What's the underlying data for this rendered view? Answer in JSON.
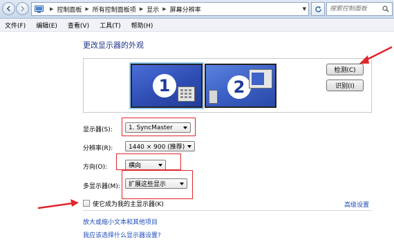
{
  "address_bar": {
    "crumbs": [
      "控制面板",
      "所有控制面板项",
      "显示",
      "屏幕分辨率"
    ],
    "search_placeholder": "搜索控制面板"
  },
  "menu": [
    "文件(F)",
    "编辑(E)",
    "查看(V)",
    "工具(T)",
    "帮助(H)"
  ],
  "page_title": "更改显示器的外观",
  "monitors": [
    "1",
    "2"
  ],
  "buttons": {
    "detect": "检测(C)",
    "identify": "识别(I)"
  },
  "fields": {
    "display": {
      "label": "显示器(S):",
      "value": "1. SyncMaster"
    },
    "resolution": {
      "label": "分辨率(R):",
      "value": "1440 × 900 (推荐)"
    },
    "orientation": {
      "label": "方向(O):",
      "value": "横向"
    },
    "multiple_displays": {
      "label": "多显示器(M):",
      "value": "扩展这些显示"
    }
  },
  "primary_checkbox": {
    "label": "使它成为我的主显示器(K)",
    "checked": false
  },
  "links": {
    "advanced": "高级设置",
    "text_size": "放大或缩小文本和其他项目",
    "which_settings": "我应该选择什么显示器设置?"
  },
  "colors": {
    "highlight": "#e0262b",
    "link": "#1e4cb8",
    "title": "#1e3287"
  }
}
